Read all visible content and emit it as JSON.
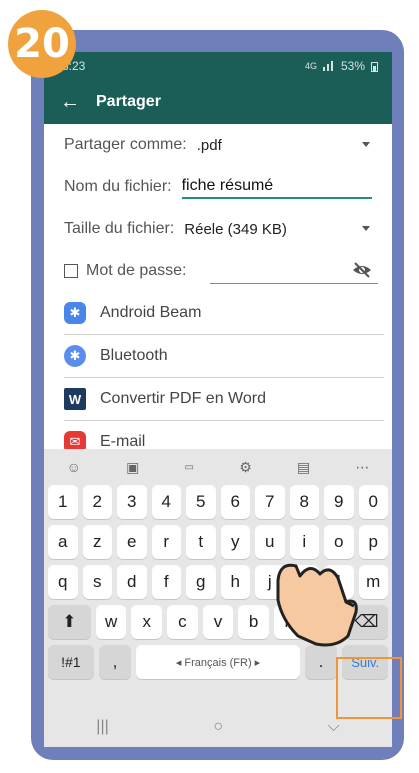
{
  "step": "20",
  "status": {
    "time": "8:23",
    "network": "4G",
    "battery": "53%"
  },
  "toolbar": {
    "back_icon": "arrow-back-icon",
    "title": "Partager"
  },
  "form": {
    "share_as_label": "Partager comme:",
    "share_as_value": ".pdf",
    "filename_label": "Nom du fichier:",
    "filename_value": "fiche résumé",
    "size_label": "Taille du fichier:",
    "size_value": "Réele (349 KB)",
    "password_label": "Mot de passe:"
  },
  "apps": [
    {
      "label": "Android Beam",
      "icon": "android-beam-icon",
      "color": "#4a86e8"
    },
    {
      "label": "Bluetooth",
      "icon": "bluetooth-icon",
      "color": "#5b8def"
    },
    {
      "label": "Convertir PDF en Word",
      "icon": "word-icon",
      "color": "#1e3a5f"
    },
    {
      "label": "E-mail",
      "icon": "email-icon",
      "color": "#e53935"
    }
  ],
  "keyboard": {
    "row1": [
      "1",
      "2",
      "3",
      "4",
      "5",
      "6",
      "7",
      "8",
      "9",
      "0"
    ],
    "row2": [
      "a",
      "z",
      "e",
      "r",
      "t",
      "y",
      "u",
      "i",
      "o",
      "p"
    ],
    "row3": [
      "q",
      "s",
      "d",
      "f",
      "g",
      "h",
      "j",
      "k",
      "l",
      "m"
    ],
    "row4": [
      "w",
      "x",
      "c",
      "v",
      "b",
      "n",
      "'"
    ],
    "symbols": "!#1",
    "comma": ",",
    "space": "◂ Français (FR) ▸",
    "period": ".",
    "next": "Suiv."
  },
  "accent": "#1b5e58",
  "highlight_color": "#f0963a"
}
